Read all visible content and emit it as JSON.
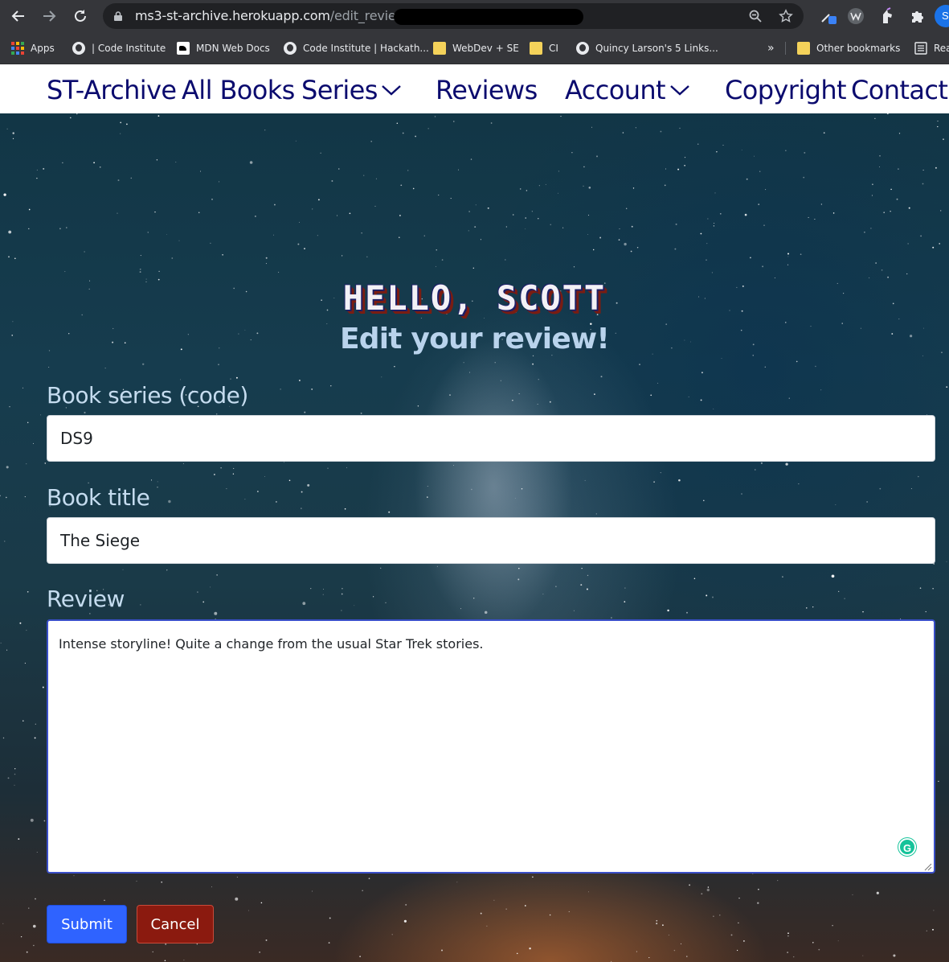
{
  "browser": {
    "url_host": "ms3-st-archive.herokuapp.com",
    "url_path": "/edit_review/",
    "icons": [
      "back-icon",
      "forward-icon",
      "reload-icon",
      "lock-icon",
      "zoom-icon",
      "star-icon",
      "puzzle-icon"
    ]
  },
  "bookmarks": {
    "items": [
      {
        "label": "Apps",
        "icon": "apps-icon"
      },
      {
        "label": "| Code Institute",
        "icon": "globe-icon"
      },
      {
        "label": "MDN Web Docs",
        "icon": "mdn-icon"
      },
      {
        "label": "Code Institute | Hackath...",
        "icon": "globe-icon"
      },
      {
        "label": "WebDev + SE",
        "icon": "folder-icon"
      },
      {
        "label": "CI",
        "icon": "folder-icon"
      },
      {
        "label": "Quincy Larson's 5 Links...",
        "icon": "globe-icon"
      },
      {
        "label": "»",
        "icon": ""
      },
      {
        "label": "Other bookmarks",
        "icon": "folder-icon"
      },
      {
        "label": "Rea",
        "icon": "reading-list-icon"
      }
    ],
    "profile_initial": "S"
  },
  "nav": {
    "brand": "ST-Archive",
    "all_books": "All Books",
    "series": "Series",
    "reviews": "Reviews",
    "account": "Account",
    "copyright": "Copyright",
    "contact": "Contact",
    "color": "#0b0b6e"
  },
  "hero": {
    "greeting": "HELLO, SCOTT",
    "subtitle": "Edit your review!"
  },
  "form": {
    "series_label": "Book series (code)",
    "series_value": "DS9",
    "title_label": "Book title",
    "title_value": "The Siege",
    "review_label": "Review",
    "review_value": "Intense storyline! Quite a change from the usual Star Trek stories.",
    "grammarly_glyph": "G",
    "submit_label": "Submit",
    "cancel_label": "Cancel",
    "submit_color": "#2f63ff",
    "cancel_color": "#8b1a0f"
  }
}
